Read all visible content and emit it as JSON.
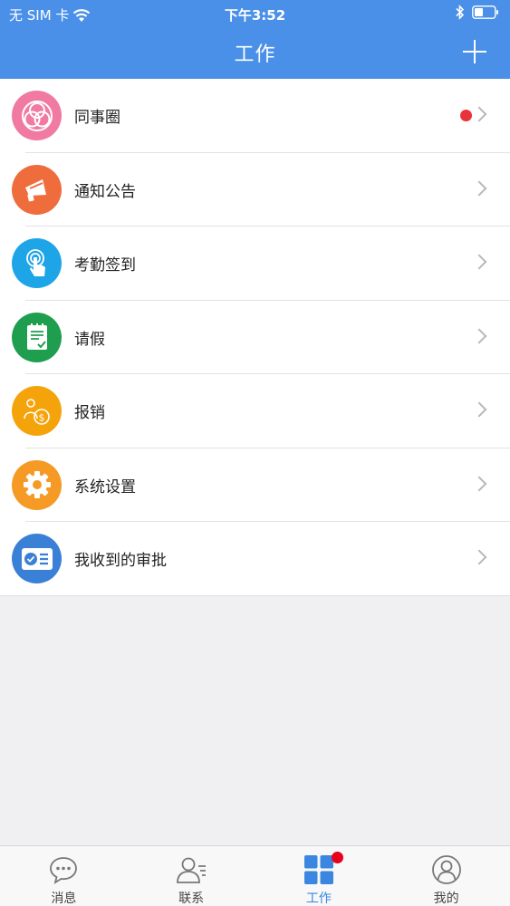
{
  "status_bar": {
    "carrier": "无 SIM 卡",
    "time": "下午3:52"
  },
  "header": {
    "title": "工作"
  },
  "colors": {
    "header": "#4a90e8",
    "tab_active": "#3a86e0",
    "badge": "#e8333a"
  },
  "menu": {
    "items": [
      {
        "label": "同事圈",
        "icon": "colleague-circle-icon",
        "color": "#f07aa2",
        "has_badge": true
      },
      {
        "label": "通知公告",
        "icon": "megaphone-icon",
        "color": "#ef6d3c",
        "has_badge": false
      },
      {
        "label": "考勤签到",
        "icon": "touch-finger-icon",
        "color": "#1ea5e8",
        "has_badge": false
      },
      {
        "label": "请假",
        "icon": "leave-form-icon",
        "color": "#1e9e4e",
        "has_badge": false
      },
      {
        "label": "报销",
        "icon": "reimbursement-icon",
        "color": "#f5a30b",
        "has_badge": false
      },
      {
        "label": "系统设置",
        "icon": "gear-icon",
        "color": "#f59a24",
        "has_badge": false
      },
      {
        "label": "我收到的审批",
        "icon": "approval-card-icon",
        "color": "#3a80d6",
        "has_badge": false
      }
    ]
  },
  "tabbar": {
    "tabs": [
      {
        "label": "消息",
        "icon": "chat-bubble-icon",
        "active": false
      },
      {
        "label": "联系",
        "icon": "contacts-icon",
        "active": false
      },
      {
        "label": "工作",
        "icon": "grid-icon",
        "active": true,
        "has_badge": true
      },
      {
        "label": "我的",
        "icon": "user-profile-icon",
        "active": false
      }
    ]
  }
}
